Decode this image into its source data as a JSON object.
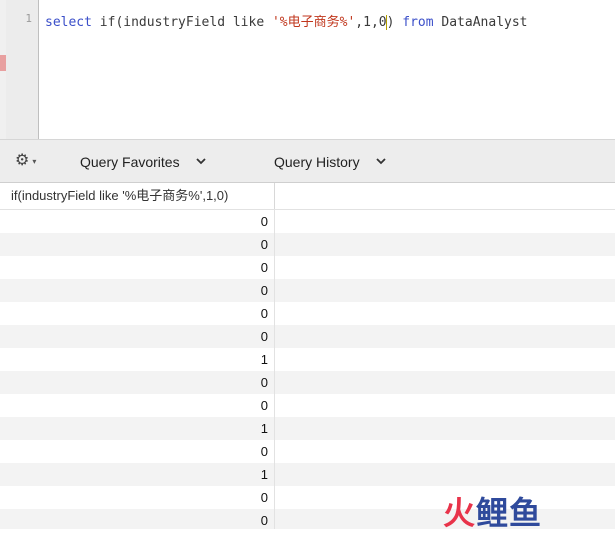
{
  "editor": {
    "line_number": "1",
    "code_keyword1": "select",
    "code_part1": " if(industryField like ",
    "code_string": "'%电子商务%'",
    "code_part2": ",1,0",
    "code_part3": ") ",
    "code_keyword2": "from",
    "code_part4": " DataAnalyst"
  },
  "toolbar": {
    "gear_icon": "gear-icon",
    "gear_caret": "▾",
    "favorites_label": "Query Favorites",
    "history_label": "Query History",
    "chevron": "⌄"
  },
  "results": {
    "column_header": "if(industryField like '%电子商务%',1,0)",
    "rows": [
      "0",
      "0",
      "0",
      "0",
      "0",
      "0",
      "1",
      "0",
      "0",
      "1",
      "0",
      "1",
      "0",
      "0"
    ]
  },
  "watermark": {
    "part1": "火",
    "part2": "鲤鱼"
  }
}
